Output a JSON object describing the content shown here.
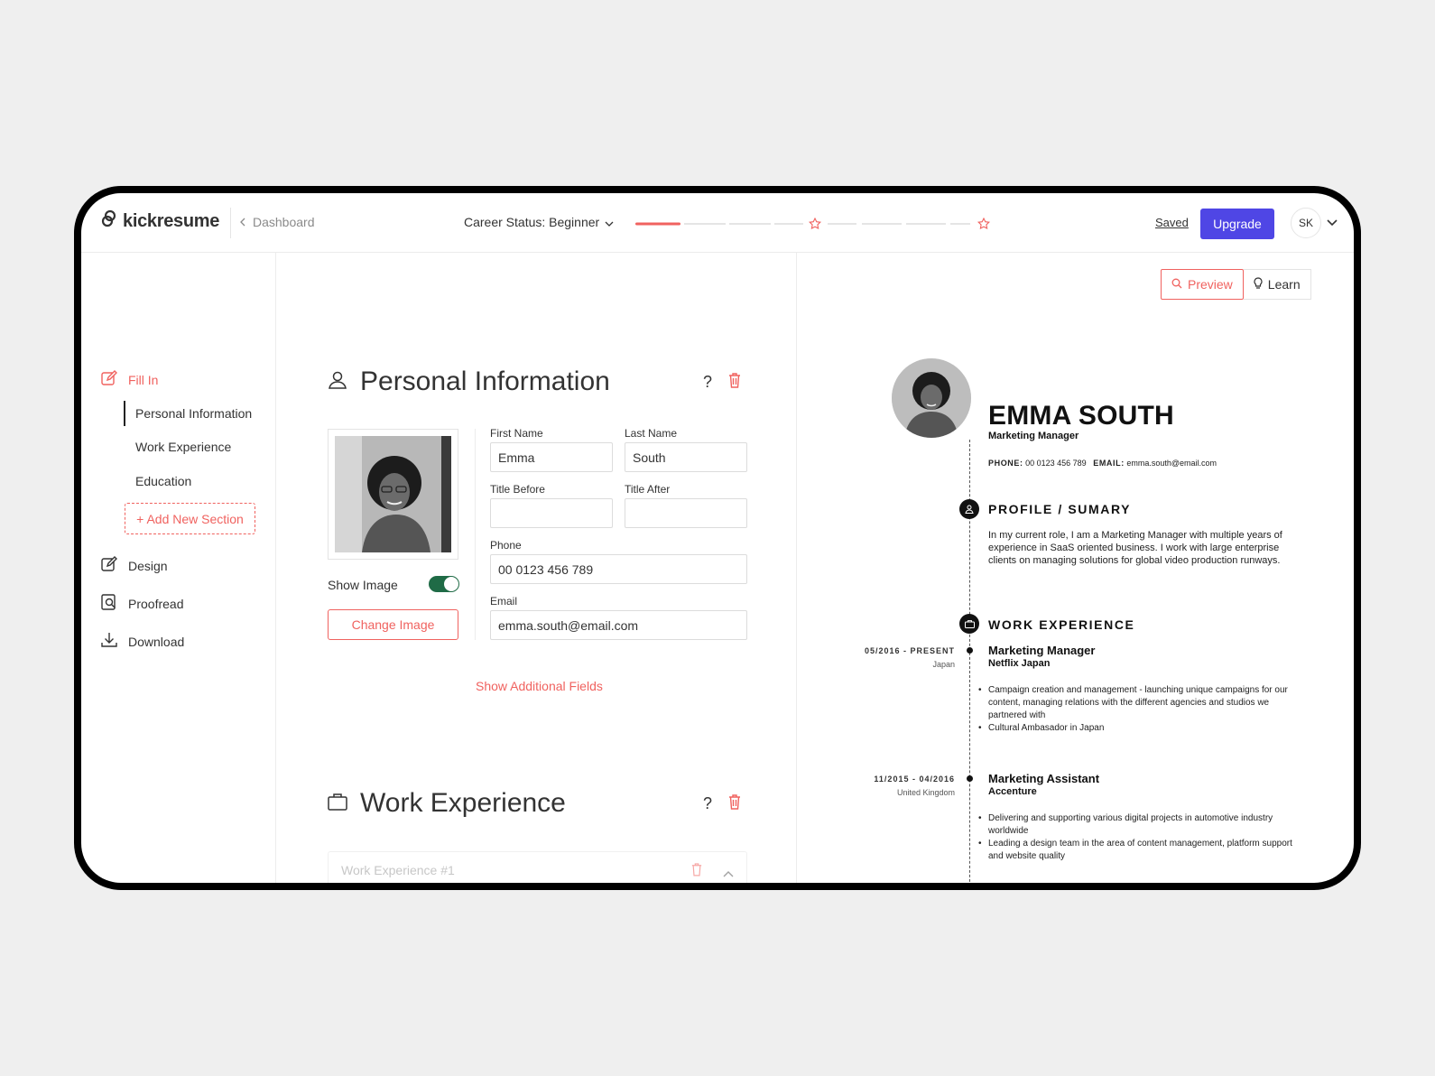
{
  "app": {
    "logo_text": "kickresume",
    "back_label": "Dashboard",
    "career_status": "Career Status: Beginner",
    "progress_level": 0.12,
    "saved_label": "Saved",
    "upgrade_label": "Upgrade",
    "user_initials": "SK",
    "accent_color": "#f0625f",
    "primary_color": "#4f46e5"
  },
  "sidebar": {
    "fill_in": "Fill In",
    "sub_items": [
      "Personal Information",
      "Work Experience",
      "Education"
    ],
    "add_section": "+ Add New Section",
    "design": "Design",
    "proofread": "Proofread",
    "download": "Download"
  },
  "personal": {
    "title": "Personal Information",
    "help": "?",
    "show_image": "Show Image",
    "change_image": "Change Image",
    "first_name_label": "First Name",
    "first_name": "Emma",
    "last_name_label": "Last Name",
    "last_name": "South",
    "title_before_label": "Title Before",
    "title_before": "",
    "title_after_label": "Title After",
    "title_after": "",
    "phone_label": "Phone",
    "phone": "00 0123 456 789",
    "email_label": "Email",
    "email": "emma.south@email.com",
    "show_more": "Show Additional Fields"
  },
  "work": {
    "title": "Work Experience",
    "help": "?",
    "card_label": "Work Experience #1"
  },
  "preview_pane": {
    "preview_label": "Preview",
    "learn_label": "Learn"
  },
  "resume": {
    "name": "EMMA SOUTH",
    "job_title": "Marketing Manager",
    "phone_key": "PHONE:",
    "phone": "00 0123 456 789",
    "email_key": "EMAIL:",
    "email": "emma.south@email.com",
    "profile_title": "PROFILE / SUMARY",
    "profile_text": "In my current role, I am a Marketing Manager with multiple years of experience in SaaS oriented business. I work with large enterprise clients on managing solutions for global video production runways.",
    "work_title": "WORK EXPERIENCE",
    "jobs": [
      {
        "dates": "05/2016 - PRESENT",
        "location": "Japan",
        "role": "Marketing Manager",
        "company": "Netflix Japan",
        "bullets": [
          "Campaign creation and management - launching unique campaigns for our content, managing relations with the different agencies and studios we partnered with",
          "Cultural Ambasador in Japan"
        ]
      },
      {
        "dates": "11/2015 - 04/2016",
        "location": "United Kingdom",
        "role": "Marketing Assistant",
        "company": "Accenture",
        "bullets": [
          "Delivering and supporting various digital projects in automotive industry worldwide",
          "Leading a design team in the area of content management, platform support and website quality"
        ]
      }
    ]
  }
}
